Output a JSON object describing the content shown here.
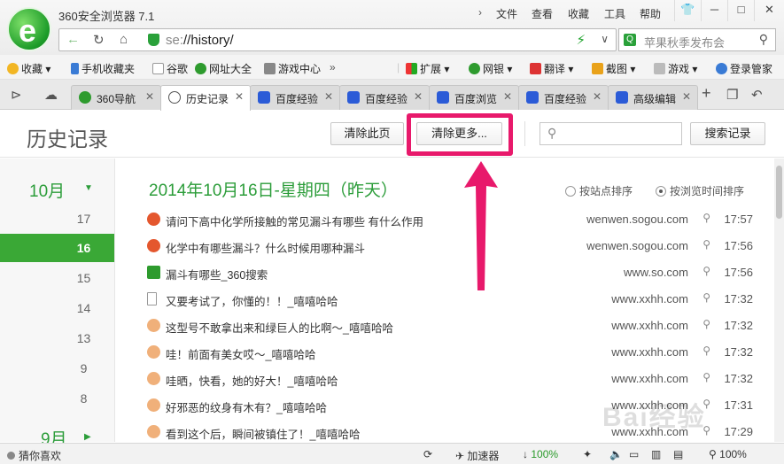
{
  "window": {
    "title": "360安全浏览器 7.1",
    "menu": [
      "文件",
      "查看",
      "收藏",
      "工具",
      "帮助"
    ],
    "controls": [
      "shirt-icon",
      "minimize-icon",
      "maximize-icon",
      "close-icon"
    ]
  },
  "address": {
    "scheme": "se:",
    "path": "//history/",
    "search_placeholder": "苹果秋季发布会"
  },
  "bookmarks": {
    "left": [
      "收藏",
      "手机收藏夹",
      "谷歌",
      "网址大全",
      "游戏中心"
    ],
    "right": [
      "扩展",
      "网银",
      "翻译",
      "截图",
      "游戏",
      "登录管家"
    ]
  },
  "tabs": [
    {
      "label": "360导航",
      "icon": "360-icon"
    },
    {
      "label": "历史记录",
      "icon": "clock-icon",
      "active": true
    },
    {
      "label": "百度经验",
      "icon": "baidu-icon"
    },
    {
      "label": "百度经验",
      "icon": "baidu-icon"
    },
    {
      "label": "百度浏览",
      "icon": "baidu-icon"
    },
    {
      "label": "百度经验",
      "icon": "baidu-icon"
    },
    {
      "label": "高级编辑",
      "icon": "baidu-icon"
    }
  ],
  "page": {
    "title": "历史记录",
    "clear_page_label": "清除此页",
    "clear_more_label": "清除更多...",
    "search_button_label": "搜索记录"
  },
  "calendar": {
    "month_current": "10月",
    "days": [
      "17",
      "16",
      "15",
      "14",
      "13",
      "9",
      "8"
    ],
    "selected_day": "16",
    "month_prev": "9月"
  },
  "list": {
    "date_heading": "2014年10月16日-星期四（昨天）",
    "sort_by_site": "按站点排序",
    "sort_by_time": "按浏览时间排序",
    "items": [
      {
        "title": "请问下高中化学所接触的常见漏斗有哪些 有什么作用",
        "domain": "wenwen.sogou.com",
        "time": "17:57",
        "icon": "sogou"
      },
      {
        "title": "化学中有哪些漏斗？什么时候用哪种漏斗",
        "domain": "wenwen.sogou.com",
        "time": "17:56",
        "icon": "sogou"
      },
      {
        "title": "漏斗有哪些_360搜索",
        "domain": "www.so.com",
        "time": "17:56",
        "icon": "so"
      },
      {
        "title": "又要考试了，你懂的！！_嘻嘻哈哈",
        "domain": "www.xxhh.com",
        "time": "17:32",
        "icon": "page"
      },
      {
        "title": "这型号不敢拿出来和绿巨人的比啊～_嘻嘻哈哈",
        "domain": "www.xxhh.com",
        "time": "17:32",
        "icon": "xxhh"
      },
      {
        "title": "哇！前面有美女哎～_嘻嘻哈哈",
        "domain": "www.xxhh.com",
        "time": "17:32",
        "icon": "xxhh"
      },
      {
        "title": "哇晒，快看，她的好大！_嘻嘻哈哈",
        "domain": "www.xxhh.com",
        "time": "17:32",
        "icon": "xxhh"
      },
      {
        "title": "好邪恶的纹身有木有？_嘻嘻哈哈",
        "domain": "www.xxhh.com",
        "time": "17:31",
        "icon": "xxhh"
      },
      {
        "title": "看到这个后，瞬间被镇住了！_嘻嘻哈哈",
        "domain": "www.xxhh.com",
        "time": "17:29",
        "icon": "xxhh"
      }
    ]
  },
  "status": {
    "guess": "猜你喜欢",
    "accelerator": "加速器",
    "download_pct": "100%",
    "zoom": "100%"
  }
}
